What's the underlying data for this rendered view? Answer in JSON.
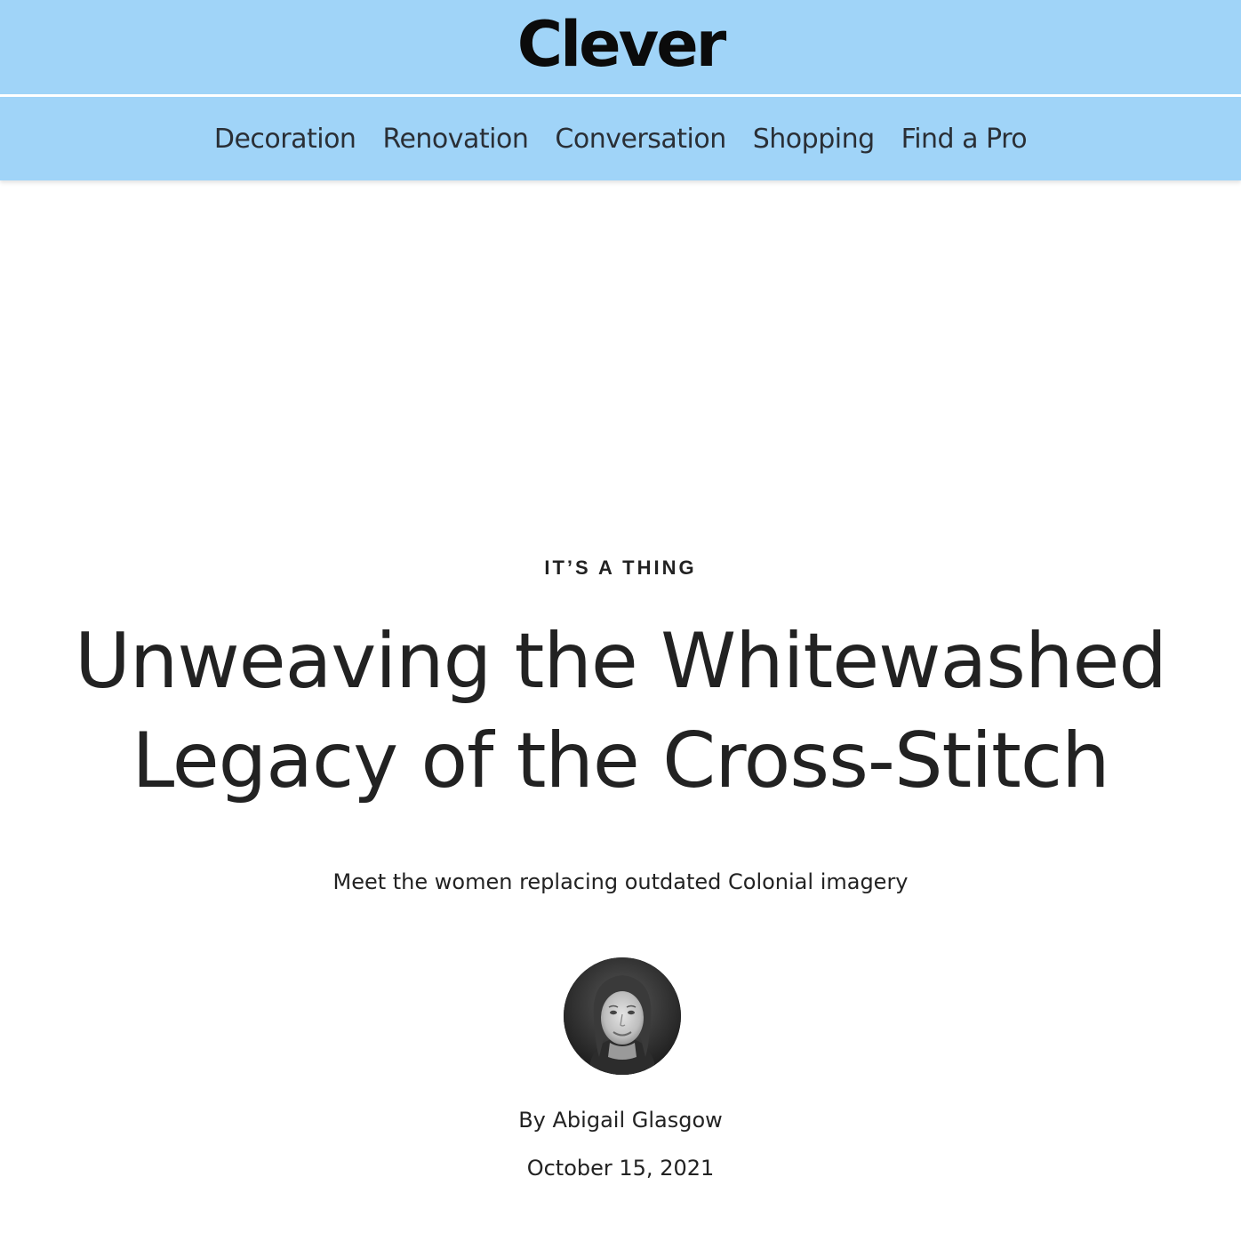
{
  "header": {
    "logo": "Clever"
  },
  "nav": {
    "items": [
      {
        "label": "Decoration"
      },
      {
        "label": "Renovation"
      },
      {
        "label": "Conversation"
      },
      {
        "label": "Shopping"
      },
      {
        "label": "Find a Pro"
      }
    ]
  },
  "article": {
    "kicker": "IT’S A THING",
    "headline": "Unweaving the Whitewashed Legacy of the Cross-Stitch",
    "dek": "Meet the women replacing outdated Colonial imagery",
    "byline": "By Abigail Glasgow",
    "date": "October 15, 2021",
    "author_avatar": "author-photo"
  },
  "colors": {
    "header_bg": "#a0d4f8",
    "text": "#222222",
    "logo": "#0b0b0b"
  }
}
